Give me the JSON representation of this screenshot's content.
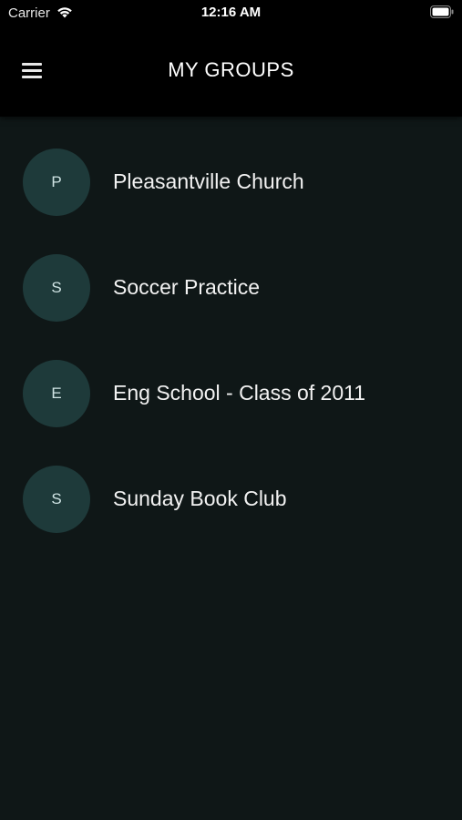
{
  "status_bar": {
    "carrier": "Carrier",
    "time": "12:16 AM",
    "wifi_icon": "wifi-icon",
    "battery_icon": "battery-icon"
  },
  "header": {
    "title": "MY GROUPS",
    "menu_icon": "hamburger-menu-icon"
  },
  "groups": [
    {
      "initial": "P",
      "name": "Pleasantville Church"
    },
    {
      "initial": "S",
      "name": "Soccer Practice"
    },
    {
      "initial": "E",
      "name": "Eng School - Class of 2011"
    },
    {
      "initial": "S",
      "name": "Sunday Book Club"
    }
  ],
  "colors": {
    "background": "#0f1717",
    "header_background": "#000000",
    "avatar_background": "#1e3a3a",
    "text": "#f2f2f2"
  }
}
